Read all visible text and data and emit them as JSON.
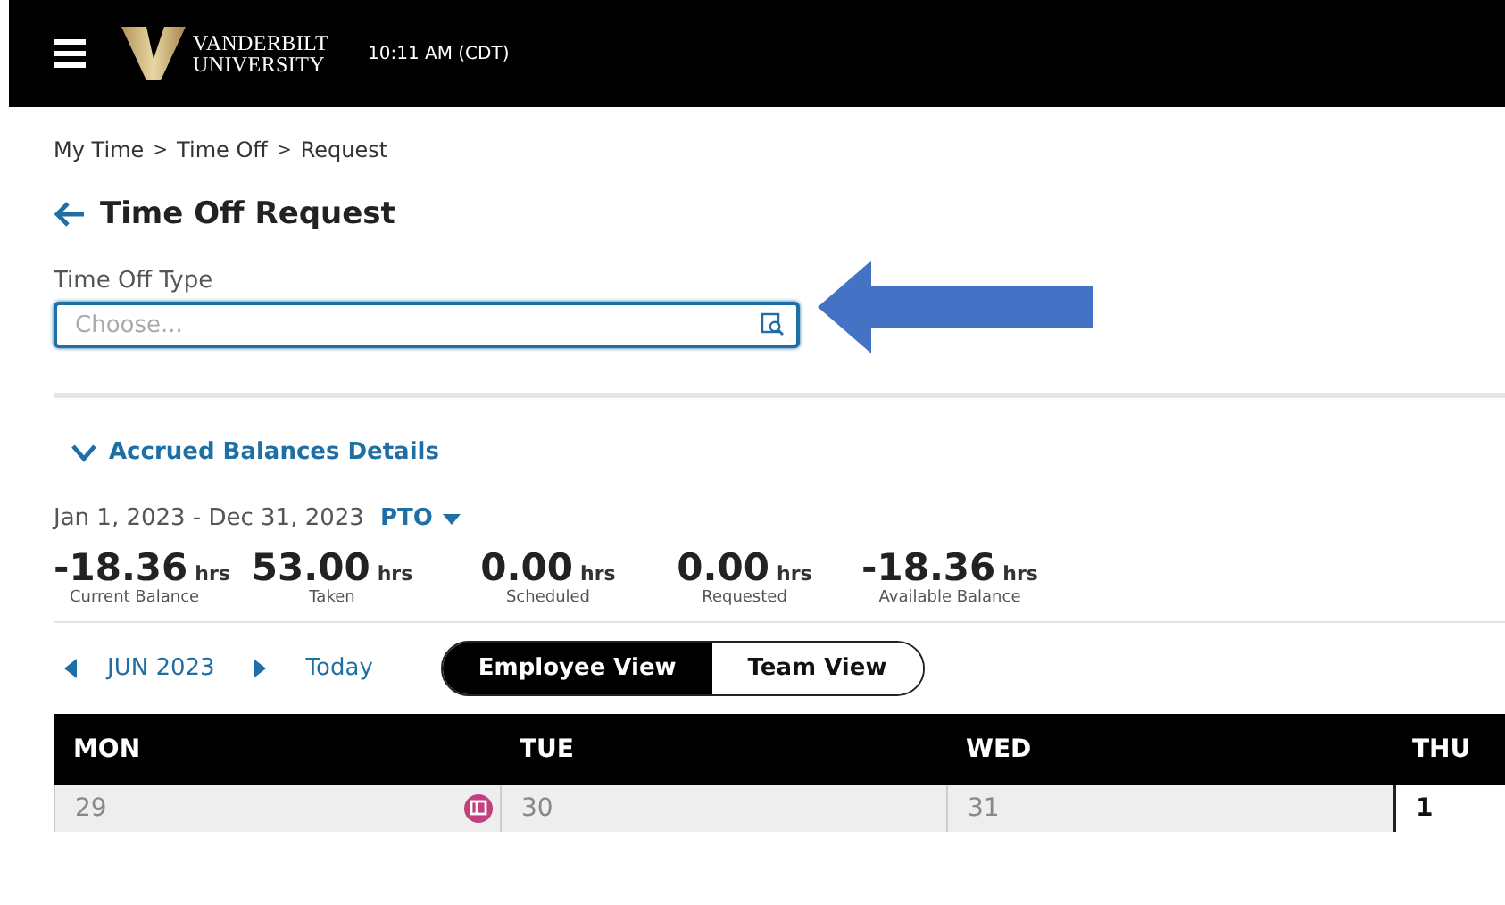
{
  "header": {
    "logo_line_1": "VANDERBILT",
    "logo_line_2": "UNIVERSITY",
    "time": "10:11 AM (CDT)"
  },
  "breadcrumb": [
    "My Time",
    ">",
    "Time Off",
    ">",
    "Request"
  ],
  "page_title": "Time Off Request",
  "time_off_type": {
    "label": "Time Off Type",
    "placeholder": "Choose..."
  },
  "balances": {
    "toggle": "Accrued Balances Details",
    "expanded": true,
    "period": "Jan 1, 2023 - Dec 31, 2023",
    "plan": "PTO",
    "items": [
      {
        "value": "-18.36",
        "unit": "hrs",
        "label": "Current Balance"
      },
      {
        "value": "53.00",
        "unit": "hrs",
        "label": "Taken"
      },
      {
        "value": "0.00",
        "unit": "hrs",
        "label": "Scheduled"
      },
      {
        "value": "0.00",
        "unit": "hrs",
        "label": "Requested"
      },
      {
        "value": "-18.36",
        "unit": "hrs",
        "label": "Available Balance"
      }
    ]
  },
  "calendar": {
    "month": "JUN 2023",
    "today": "Today",
    "views": [
      {
        "label": "Employee View",
        "selected": true
      },
      {
        "label": "Team View",
        "selected": false
      }
    ],
    "days": [
      "MON",
      "TUE",
      "WED",
      "THU"
    ],
    "cells": [
      {
        "date": "29",
        "in_month": false,
        "has_event": true
      },
      {
        "date": "30",
        "in_month": false,
        "has_event": false
      },
      {
        "date": "31",
        "in_month": false,
        "has_event": false
      },
      {
        "date": "1",
        "in_month": true,
        "has_event": false
      }
    ]
  }
}
